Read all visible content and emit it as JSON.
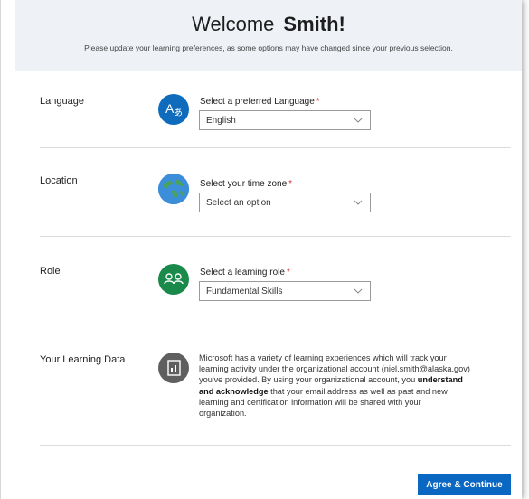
{
  "header": {
    "welcome": "Welcome",
    "user_name": "Smith!",
    "subtitle": "Please update your learning preferences, as some options may have changed since your previous selection."
  },
  "sections": {
    "language": {
      "label": "Language",
      "field_label": "Select a preferred Language",
      "required_mark": "*",
      "value": "English",
      "icon": "translate-icon",
      "icon_color": "#0f6cbd"
    },
    "location": {
      "label": "Location",
      "field_label": "Select your time zone",
      "required_mark": "*",
      "value": "Select an option",
      "icon": "globe-icon"
    },
    "role": {
      "label": "Role",
      "field_label": "Select a learning role",
      "required_mark": "*",
      "value": "Fundamental Skills",
      "icon": "people-icon",
      "icon_color": "#1a8a4a"
    },
    "learning_data": {
      "label": "Your Learning Data",
      "icon": "report-icon",
      "icon_color": "#5f5f5f",
      "text_part1": "Microsoft has a variety of learning experiences which will track your learning activity under the organizational account (niel.smith@alaska.gov)  you've provided. By using your organizational account, you ",
      "text_bold": "understand and acknowledge",
      "text_part2": " that your email address as well as past and new learning and certification information will be shared with your organization."
    }
  },
  "footer": {
    "agree_label": "Agree & Continue"
  },
  "colors": {
    "accent": "#0a67c2",
    "required": "#d13438",
    "header_bg": "#eef2f7"
  }
}
